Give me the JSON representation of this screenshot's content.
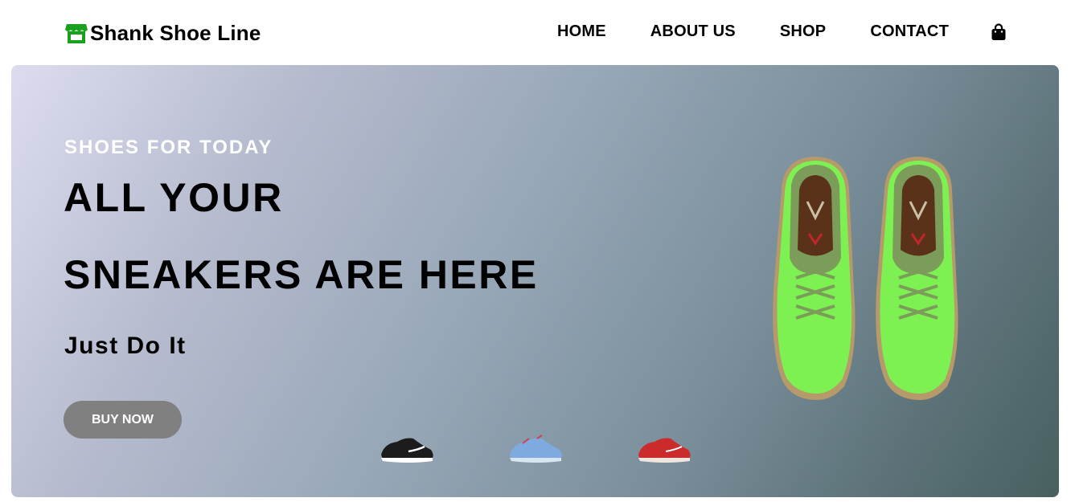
{
  "brand": {
    "name": "Shank Shoe Line",
    "icon": "storefront-icon",
    "icon_color": "#18a11c"
  },
  "nav": {
    "items": [
      {
        "label": "HOME"
      },
      {
        "label": "ABOUT US"
      },
      {
        "label": "SHOP"
      },
      {
        "label": "CONTACT"
      }
    ],
    "cart_icon": "shopping-bag-icon"
  },
  "hero": {
    "eyebrow": "SHOES FOR TODAY",
    "headline_line1": "ALL YOUR",
    "headline_line2": "SNEAKERS ARE HERE",
    "tagline": "Just Do It",
    "cta_label": "BUY NOW",
    "featured_product": "lime-green-sneaker-pair",
    "thumbnails": [
      {
        "name": "black-sneaker",
        "color": "#1c1c1c"
      },
      {
        "name": "blue-sneaker",
        "color": "#7eaadf"
      },
      {
        "name": "red-sneaker",
        "color": "#cc2b2b"
      }
    ]
  },
  "colors": {
    "button_bg": "#808080",
    "hero_gradient_start": "#dcdcef",
    "hero_gradient_end": "#47605f",
    "sneaker_green": "#7df052"
  }
}
